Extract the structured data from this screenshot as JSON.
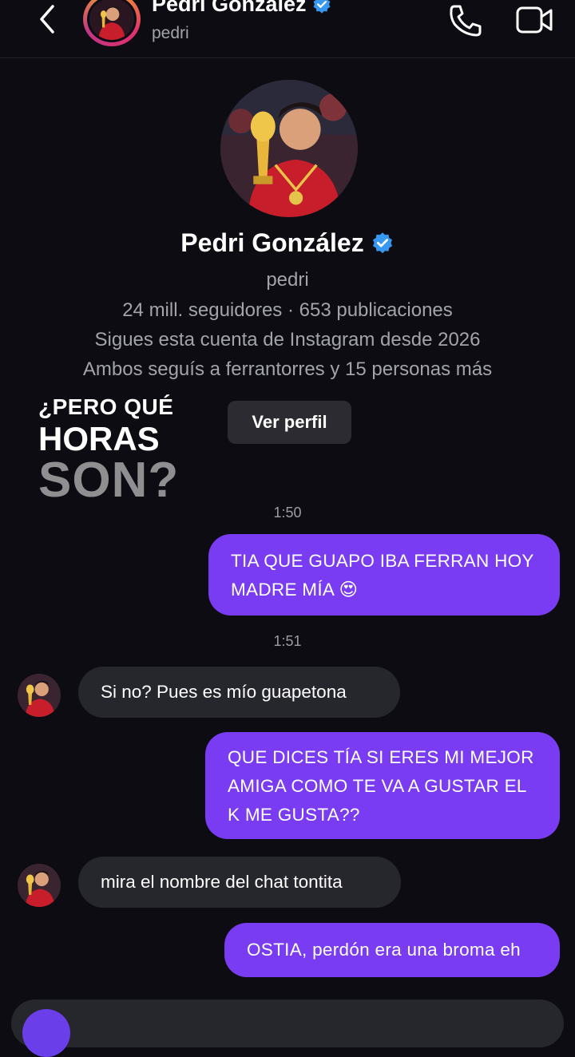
{
  "header": {
    "name": "Pedri González",
    "username": "pedri"
  },
  "profile": {
    "name": "Pedri González",
    "username": "pedri",
    "stats": "24 mill. seguidores · 653 publicaciones",
    "follow_since": "Sigues esta cuenta de Instagram desde 2026",
    "mutual": "Ambos seguís a ferrantorres y 15 personas más",
    "view_profile_label": "Ver perfil"
  },
  "watermark": {
    "line1": "¿PERO QUÉ",
    "line2": "HORAS",
    "line3": "SON?"
  },
  "chat": {
    "timestamps": [
      "1:50",
      "1:51"
    ],
    "messages": [
      {
        "direction": "out",
        "text_lines": [
          "TIA QUE GUAPO IBA FERRAN HOY",
          "MADRE MÍA 😍"
        ]
      },
      {
        "direction": "in",
        "text": "Si no? Pues es mío guapetona"
      },
      {
        "direction": "out",
        "text_lines": [
          "QUE DICES TÍA SI ERES MI MEJOR",
          "AMIGA COMO TE VA A GUSTAR EL",
          "K ME GUSTA??"
        ]
      },
      {
        "direction": "in",
        "text": "mira el nombre del chat tontita"
      },
      {
        "direction": "out",
        "text": "OSTIA, perdón era una broma eh"
      }
    ]
  },
  "colors": {
    "background": "#0c0c12",
    "outgoing_bubble": "#7a3cf2",
    "incoming_bubble": "#26262d",
    "verified_badge": "#3897f0"
  },
  "icons": [
    "back-arrow-icon",
    "verified-badge-icon",
    "phone-icon",
    "video-camera-icon",
    "camera-icon"
  ]
}
